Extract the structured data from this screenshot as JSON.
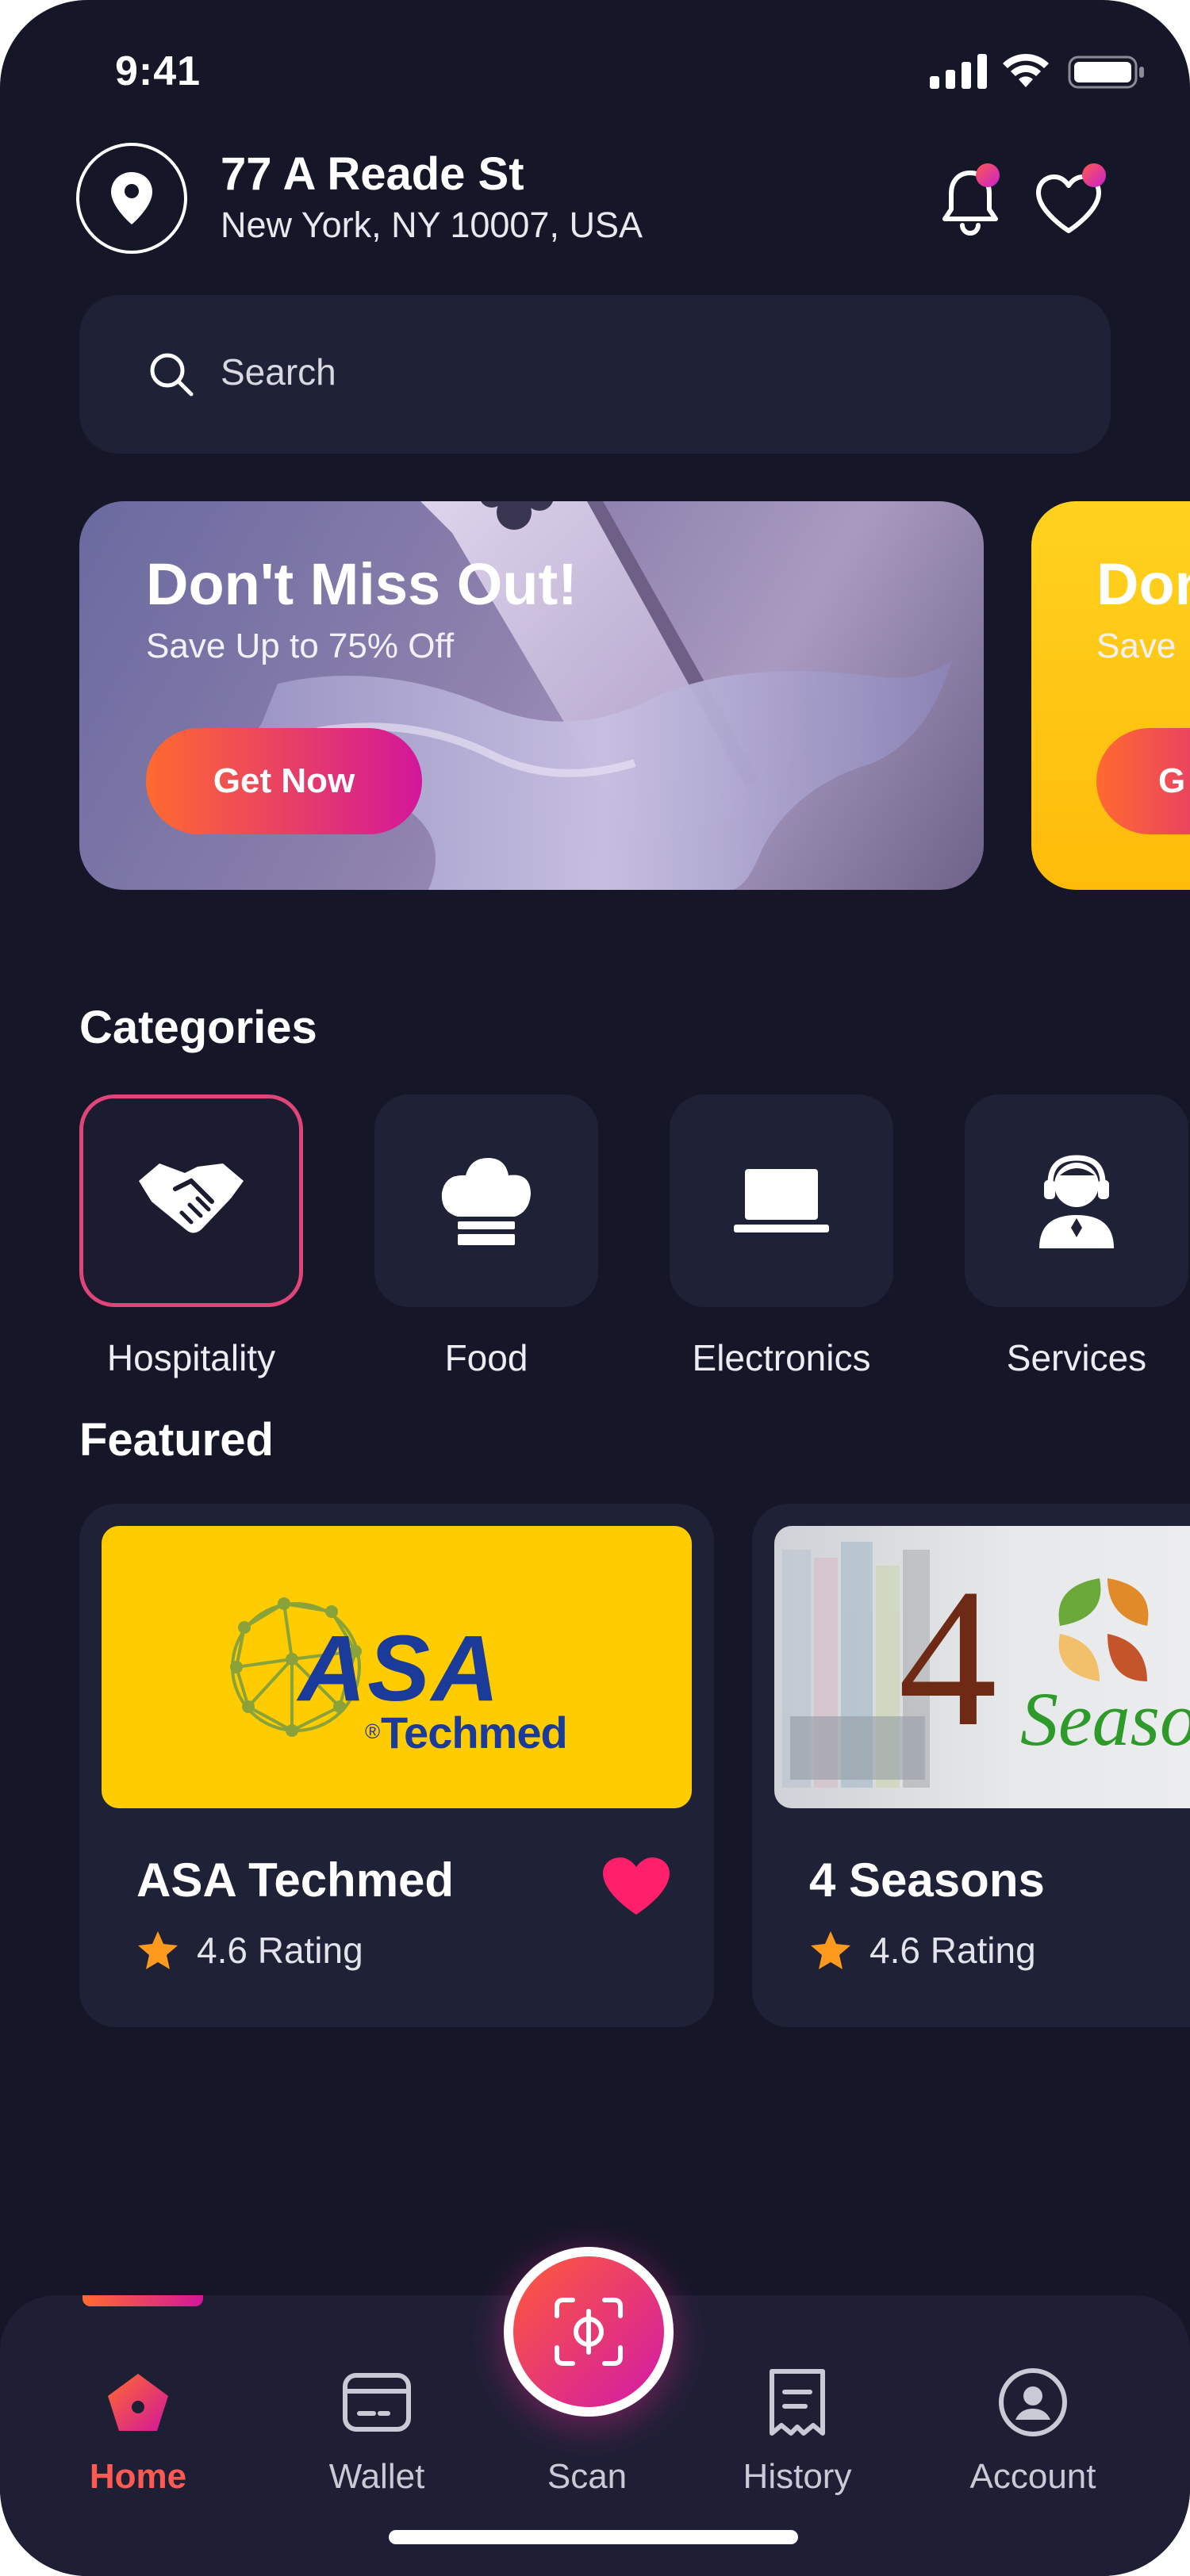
{
  "status_bar": {
    "time": "9:41"
  },
  "header": {
    "address_line1": "77 A Reade St",
    "address_line2": "New York, NY 10007, USA"
  },
  "search": {
    "placeholder": "Search"
  },
  "banners": [
    {
      "title": "Don't Miss Out!",
      "subtitle": "Save Up to 75% Off",
      "button": "Get Now"
    },
    {
      "title": "Don",
      "subtitle": "Save",
      "button": "G"
    }
  ],
  "categories": {
    "title": "Categories",
    "items": [
      {
        "label": "Hospitality",
        "icon": "handshake-icon",
        "active": true
      },
      {
        "label": "Food",
        "icon": "chef-hat-icon"
      },
      {
        "label": "Electronics",
        "icon": "laptop-icon"
      },
      {
        "label": "Services",
        "icon": "support-agent-icon"
      }
    ]
  },
  "featured": {
    "title": "Featured",
    "items": [
      {
        "name": "ASA Techmed",
        "rating": "4.6 Rating",
        "logo_text": "ASA",
        "logo_subtext": "Techmed",
        "logo_mark": "®",
        "favorited": true
      },
      {
        "name": "4 Seasons",
        "rating": "4.6 Rating",
        "logo_text": "4",
        "logo_subtext": "Season",
        "favorited": false
      }
    ]
  },
  "tabbar": {
    "items": [
      {
        "label": "Home",
        "icon": "home-icon",
        "active": true
      },
      {
        "label": "Wallet",
        "icon": "wallet-icon"
      },
      {
        "label": "Scan",
        "icon": "scan-icon"
      },
      {
        "label": "History",
        "icon": "receipt-icon"
      },
      {
        "label": "Account",
        "icon": "account-icon"
      }
    ]
  },
  "colors": {
    "background": "#151628",
    "surface": "#1f2136",
    "accent_start": "#ff6a2f",
    "accent_end": "#d2179a",
    "star": "#ff9a1f",
    "heart": "#ff1f6b",
    "banner2": "#ffc714",
    "asa_bg": "#ffcc00"
  }
}
